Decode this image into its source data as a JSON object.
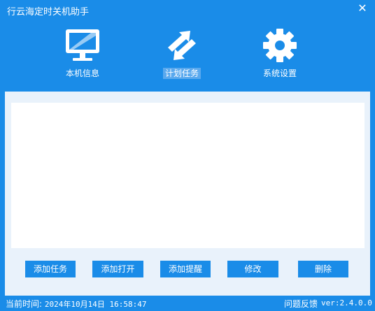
{
  "window": {
    "title": "行云海定时关机助手",
    "close_glyph": "✕"
  },
  "nav": {
    "items": [
      {
        "label": "本机信息",
        "icon": "monitor-icon",
        "active": false
      },
      {
        "label": "计划任务",
        "icon": "schedule-arrows-icon",
        "active": true
      },
      {
        "label": "系统设置",
        "icon": "gear-icon",
        "active": false
      }
    ]
  },
  "task_list": {
    "rows": []
  },
  "buttons": {
    "add_task": "添加任务",
    "add_open": "添加打开",
    "add_reminder": "添加提醒",
    "modify": "修改",
    "delete": "删除"
  },
  "status": {
    "time_label": "当前时间:",
    "time_value": "2024年10月14日 16:58:47",
    "feedback": "问题反馈",
    "version": "ver:2.4.0.0"
  },
  "colors": {
    "primary": "#1a8ce8",
    "panel_bg": "#e9f2fb",
    "active_tab_bg": "#5aa9ee"
  }
}
